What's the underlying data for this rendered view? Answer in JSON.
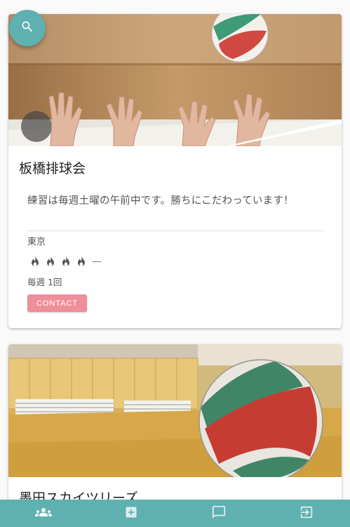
{
  "colors": {
    "accent": "#5fb0b0",
    "contact_button": "#ef8f99"
  },
  "fab": {
    "icon": "search-icon"
  },
  "cards": [
    {
      "title": "板橋排球会",
      "description": "練習は毎週土曜の午前中です。勝ちにこだわっています！",
      "location": "東京",
      "level": {
        "icon": "fire-icon",
        "filled": 4,
        "trailing": "—"
      },
      "frequency": "毎週 1回",
      "contact_label": "CONTACT",
      "photo": "volleyball-hands-photo"
    },
    {
      "title": "墨田スカイツリーズ",
      "photo": "volleyball-gym-floor-photo"
    }
  ],
  "bottom_nav": [
    {
      "icon": "group-icon"
    },
    {
      "icon": "add-box-icon"
    },
    {
      "icon": "chat-icon"
    },
    {
      "icon": "logout-icon"
    }
  ]
}
